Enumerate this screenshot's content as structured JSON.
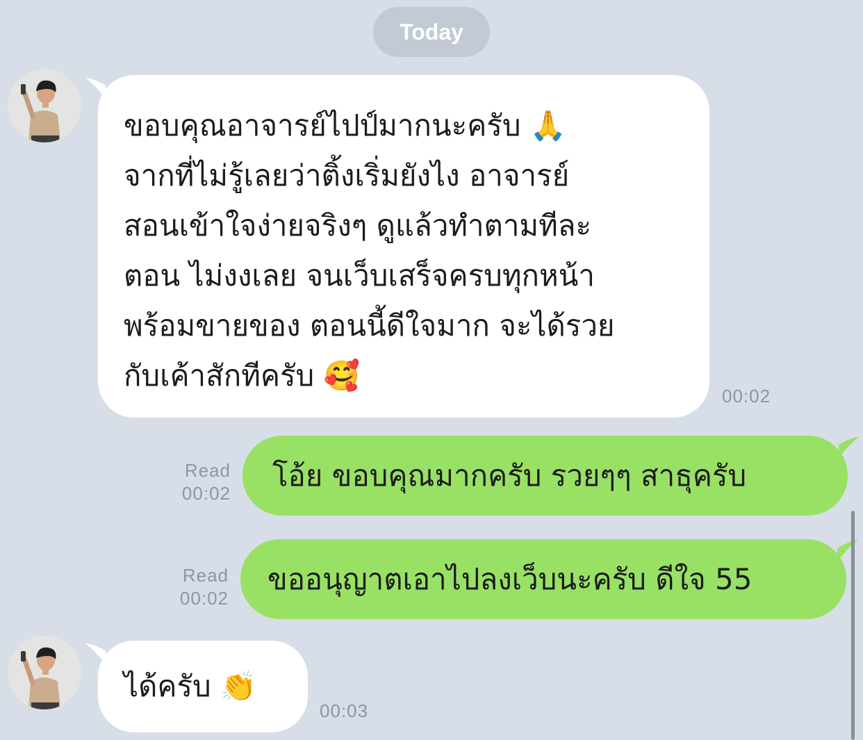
{
  "date_separator": "Today",
  "messages": [
    {
      "sender": "other",
      "text": "ขอบคุณอาจารย์ไปป์มากนะครับ 🙏\nจากที่ไม่รู้เลยว่าติ้งเริ่มยังไง อาจารย์\nสอนเข้าใจง่ายจริงๆ ดูแล้วทำตามทีละ\nตอน ไม่งงเลย จนเว็บเสร็จครบทุกหน้า\nพร้อมขายของ ตอนนี้ดีใจมาก จะได้รวย\nกับเค้าสักทีครับ 🥰",
      "time": "00:02"
    },
    {
      "sender": "me",
      "text": "โอ้ย ขอบคุณมากครับ รวยๆๆ สาธุครับ",
      "read_label": "Read",
      "time": "00:02"
    },
    {
      "sender": "me",
      "text": "ขออนุญาตเอาไปลงเว็บนะครับ ดีใจ 55",
      "read_label": "Read",
      "time": "00:02"
    },
    {
      "sender": "other",
      "text": "ได้ครับ 👏",
      "time": "00:03"
    }
  ],
  "icons": {
    "avatar": "user-photo-avatar"
  },
  "colors": {
    "background": "#d7dee7",
    "incoming_bubble": "#ffffff",
    "outgoing_bubble": "#98e165",
    "date_pill": "#c2cad3",
    "meta_text": "#8d96a3"
  }
}
